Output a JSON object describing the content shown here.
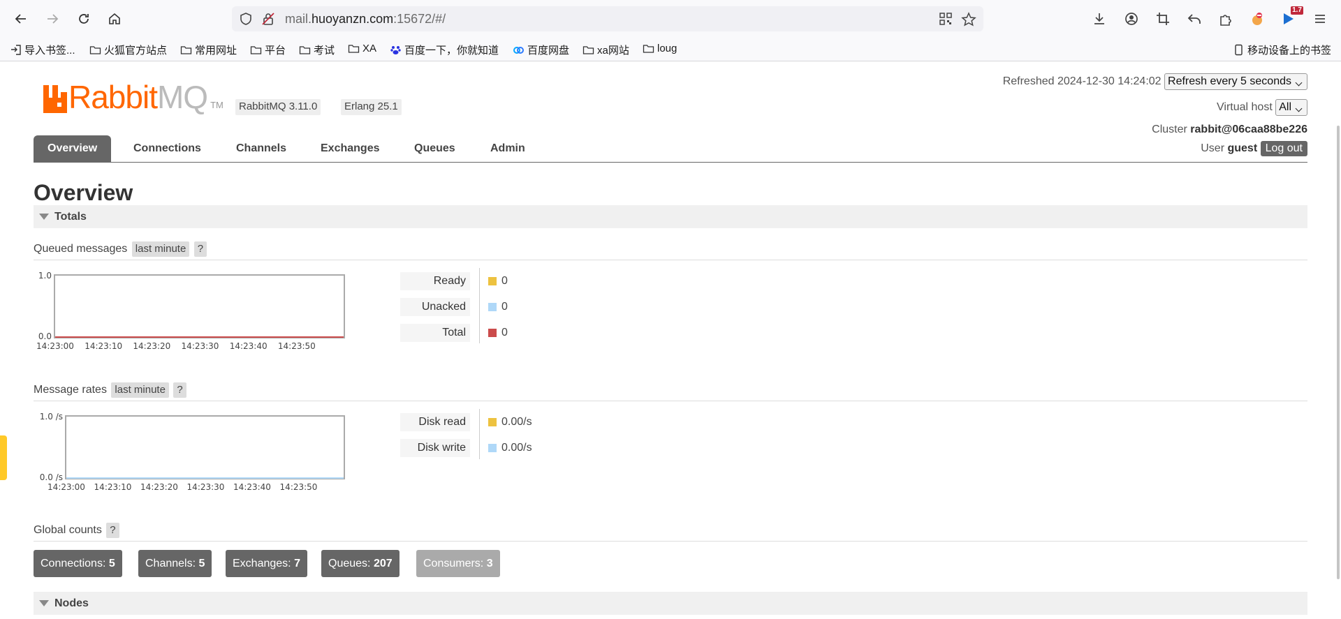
{
  "browser": {
    "url_prefix": "mail.",
    "url_host": "huoyanzn.com",
    "url_suffix": ":15672/#/",
    "extension_badge": "1.7",
    "bookmarks": [
      "导入书签...",
      "火狐官方站点",
      "常用网址",
      "平台",
      "考试",
      "XA",
      "百度一下，你就知道",
      "百度网盘",
      "xa网站",
      "loug"
    ],
    "mobile_bookmarks": "移动设备上的书签"
  },
  "header": {
    "logo_rabbit": "Rabbit",
    "logo_mq": "MQ",
    "logo_tm": "TM",
    "rabbitmq_version": "RabbitMQ 3.11.0",
    "erlang_version": "Erlang 25.1",
    "refreshed_label": "Refreshed",
    "refreshed_time": "2024-12-30 14:24:02",
    "refresh_select": "Refresh every 5 seconds",
    "vhost_label": "Virtual host",
    "vhost_select": "All",
    "cluster_label": "Cluster",
    "cluster_name": "rabbit@06caa88be226",
    "user_label": "User",
    "user_name": "guest",
    "logout": "Log out"
  },
  "tabs": [
    "Overview",
    "Connections",
    "Channels",
    "Exchanges",
    "Queues",
    "Admin"
  ],
  "page_title": "Overview",
  "totals": {
    "title": "Totals",
    "queued_title": "Queued messages",
    "queued_range": "last minute",
    "help": "?",
    "queued_legend": [
      {
        "label": "Ready",
        "value": "0",
        "color": "#edc240"
      },
      {
        "label": "Unacked",
        "value": "0",
        "color": "#afd8f8"
      },
      {
        "label": "Total",
        "value": "0",
        "color": "#cb4b4b"
      }
    ],
    "rates_title": "Message rates",
    "rates_range": "last minute",
    "rates_legend": [
      {
        "label": "Disk read",
        "value": "0.00/s",
        "color": "#edc240"
      },
      {
        "label": "Disk write",
        "value": "0.00/s",
        "color": "#afd8f8"
      }
    ],
    "global_title": "Global counts",
    "counts": [
      {
        "label": "Connections:",
        "value": "5"
      },
      {
        "label": "Channels:",
        "value": "5"
      },
      {
        "label": "Exchanges:",
        "value": "7"
      },
      {
        "label": "Queues:",
        "value": "207"
      },
      {
        "label": "Consumers:",
        "value": "3"
      }
    ]
  },
  "nodes": {
    "title": "Nodes"
  },
  "chart_data": [
    {
      "type": "line",
      "x": [
        "14:23:00",
        "14:23:10",
        "14:23:20",
        "14:23:30",
        "14:23:40",
        "14:23:50"
      ],
      "y_ticks": [
        "0.0",
        "1.0"
      ],
      "ylim": [
        0,
        1
      ],
      "series": [
        {
          "name": "Ready",
          "values": [
            0,
            0,
            0,
            0,
            0,
            0
          ],
          "color": "#edc240"
        },
        {
          "name": "Unacked",
          "values": [
            0,
            0,
            0,
            0,
            0,
            0
          ],
          "color": "#afd8f8"
        },
        {
          "name": "Total",
          "values": [
            0,
            0,
            0,
            0,
            0,
            0
          ],
          "color": "#cb4b4b"
        }
      ]
    },
    {
      "type": "line",
      "x": [
        "14:23:00",
        "14:23:10",
        "14:23:20",
        "14:23:30",
        "14:23:40",
        "14:23:50"
      ],
      "y_ticks": [
        "0.0 /s",
        "1.0 /s"
      ],
      "ylim": [
        0,
        1
      ],
      "series": [
        {
          "name": "Disk read",
          "values": [
            0,
            0,
            0,
            0,
            0,
            0
          ],
          "color": "#edc240"
        },
        {
          "name": "Disk write",
          "values": [
            0,
            0,
            0,
            0,
            0,
            0
          ],
          "color": "#afd8f8"
        }
      ]
    }
  ]
}
